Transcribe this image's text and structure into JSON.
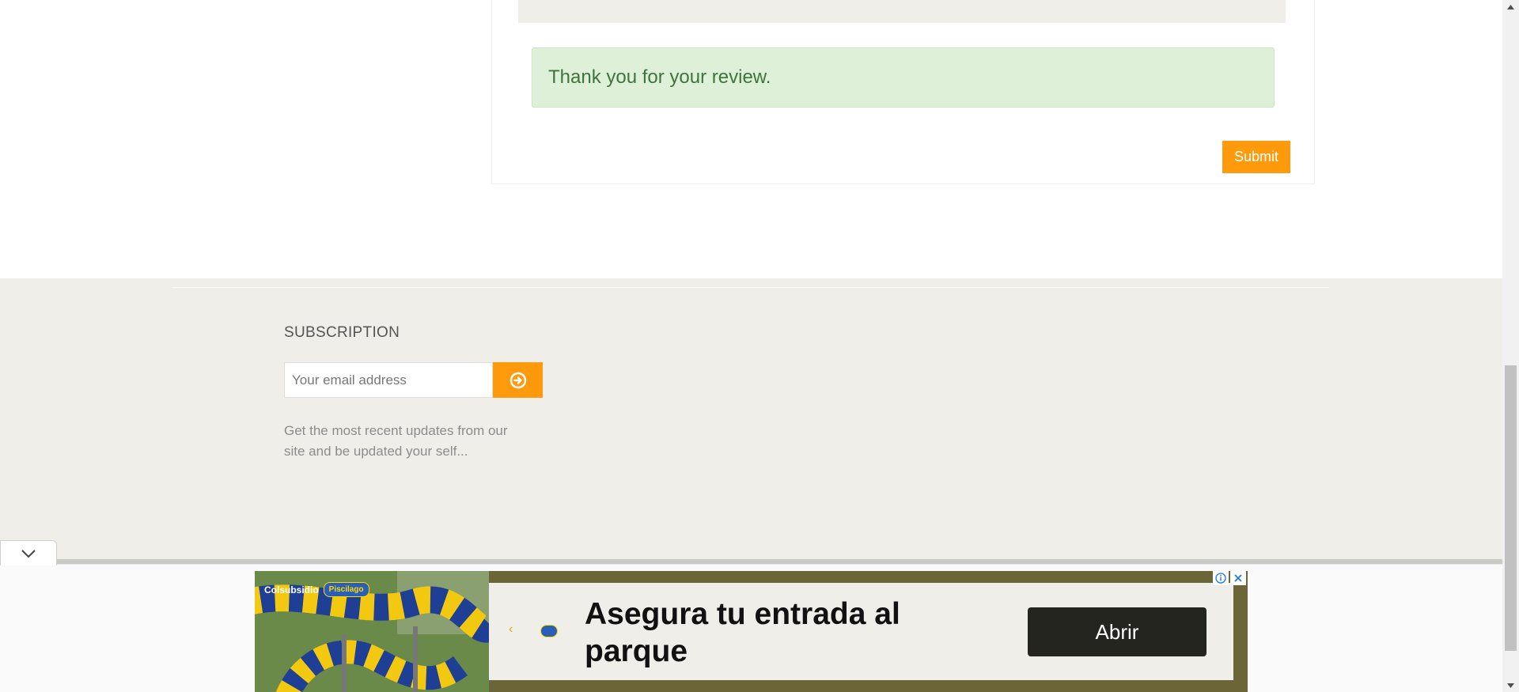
{
  "review": {
    "success_message": "Thank you for your review.",
    "submit_label": "Submit"
  },
  "footer": {
    "subscription_title": "SUBSCRIPTION",
    "email_placeholder": "Your email address",
    "description": "Get the most recent updates from our site and be updated your self..."
  },
  "ad": {
    "brand": "Colsubsidio",
    "badge": "Piscilago",
    "headline": "Asegura tu entrada al parque",
    "cta_label": "Abrir",
    "icons": [
      "ad-info-icon",
      "ad-close-icon"
    ]
  },
  "colors": {
    "accent": "#ff9a0d",
    "success_bg": "#dff0d8",
    "success_text": "#3c763d",
    "footer_bg": "#efeee8"
  }
}
